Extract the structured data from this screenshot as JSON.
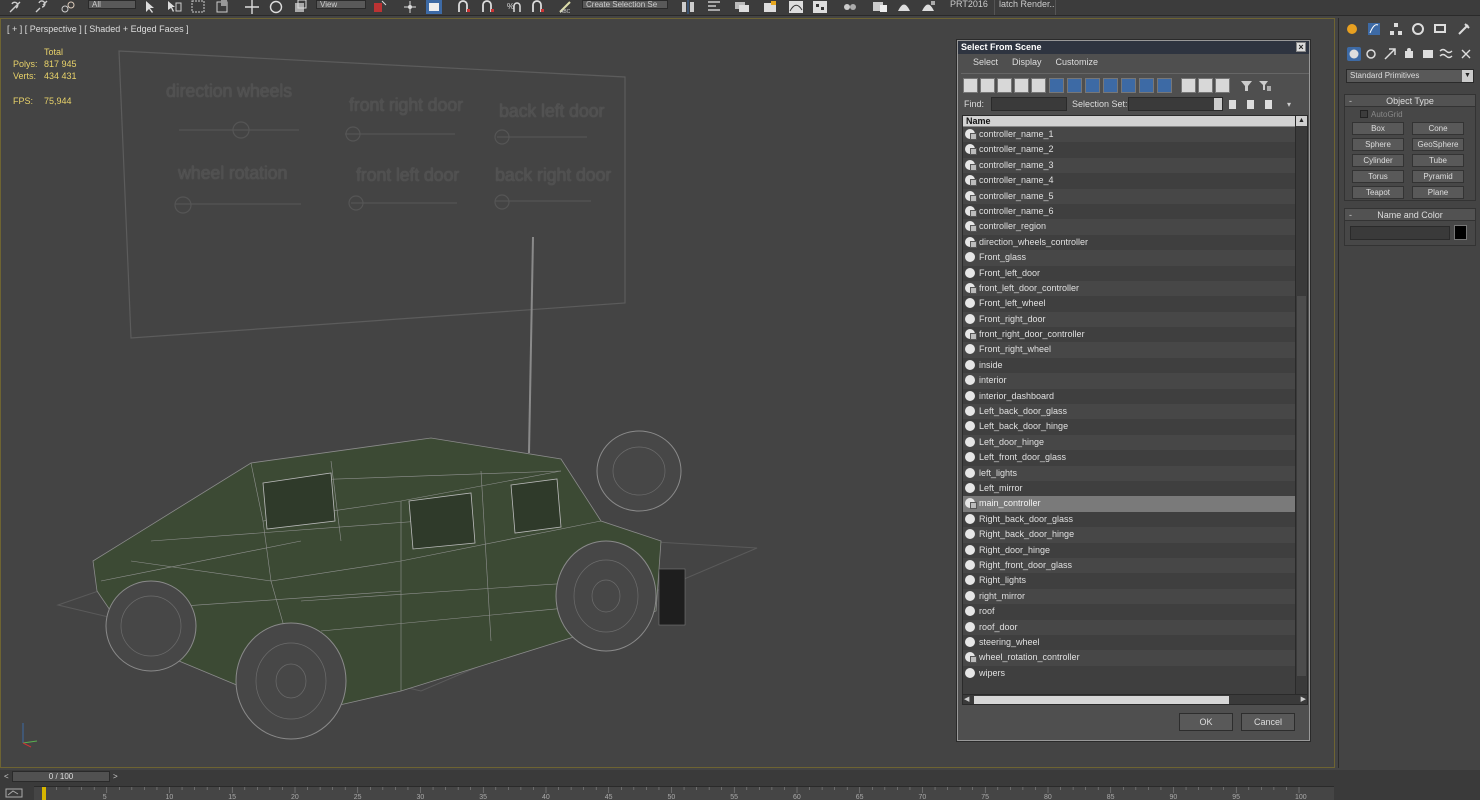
{
  "toolbar": {
    "combo_filter": "All",
    "combo_view": "View",
    "combo_selection_set": "Create Selection Se",
    "prt_label": "PRT2016",
    "batch_render_label": "latch Render.."
  },
  "viewport": {
    "label": "[ + ] [ Perspective ] [ Shaded + Edged Faces ]",
    "stats": {
      "header": "Total",
      "polys_label": "Polys:",
      "polys_value": "817 945",
      "verts_label": "Verts:",
      "verts_value": "434 431",
      "fps_label": "FPS:",
      "fps_value": "75,944"
    },
    "controller_labels": {
      "direction_wheels": "direction wheels",
      "front_right_door": "front right door",
      "back_left_door": "back left door",
      "wheel_rotation": "wheel rotation",
      "front_left_door": "front left door",
      "back_right_door": "back right door"
    }
  },
  "dialog": {
    "title": "Select From Scene",
    "close": "×",
    "menu": [
      "Select",
      "Display",
      "Customize"
    ],
    "find_label": "Find:",
    "selection_set_label": "Selection Set:",
    "column_name": "Name",
    "items": [
      {
        "name": "controller_name_1",
        "kind": "controller"
      },
      {
        "name": "controller_name_2",
        "kind": "controller"
      },
      {
        "name": "controller_name_3",
        "kind": "controller"
      },
      {
        "name": "controller_name_4",
        "kind": "controller"
      },
      {
        "name": "controller_name_5",
        "kind": "controller"
      },
      {
        "name": "controller_name_6",
        "kind": "controller"
      },
      {
        "name": "controller_region",
        "kind": "controller"
      },
      {
        "name": "direction_wheels_controller",
        "kind": "controller"
      },
      {
        "name": "Front_glass",
        "kind": "geometry"
      },
      {
        "name": "Front_left_door",
        "kind": "geometry"
      },
      {
        "name": "front_left_door_controller",
        "kind": "controller"
      },
      {
        "name": "Front_left_wheel",
        "kind": "geometry"
      },
      {
        "name": "Front_right_door",
        "kind": "geometry"
      },
      {
        "name": "front_right_door_controller",
        "kind": "controller"
      },
      {
        "name": "Front_right_wheel",
        "kind": "geometry"
      },
      {
        "name": "inside",
        "kind": "geometry"
      },
      {
        "name": "interior",
        "kind": "geometry"
      },
      {
        "name": "interior_dashboard",
        "kind": "geometry"
      },
      {
        "name": "Left_back_door_glass",
        "kind": "geometry"
      },
      {
        "name": "Left_back_door_hinge",
        "kind": "geometry"
      },
      {
        "name": "Left_door_hinge",
        "kind": "geometry"
      },
      {
        "name": "Left_front_door_glass",
        "kind": "geometry"
      },
      {
        "name": "left_lights",
        "kind": "geometry"
      },
      {
        "name": "Left_mirror",
        "kind": "geometry"
      },
      {
        "name": "main_controller",
        "kind": "controller",
        "selected": true
      },
      {
        "name": "Right_back_door_glass",
        "kind": "geometry"
      },
      {
        "name": "Right_back_door_hinge",
        "kind": "geometry"
      },
      {
        "name": "Right_door_hinge",
        "kind": "geometry"
      },
      {
        "name": "Right_front_door_glass",
        "kind": "geometry"
      },
      {
        "name": "Right_lights",
        "kind": "geometry"
      },
      {
        "name": "right_mirror",
        "kind": "geometry"
      },
      {
        "name": "roof",
        "kind": "geometry"
      },
      {
        "name": "roof_door",
        "kind": "geometry"
      },
      {
        "name": "steering_wheel",
        "kind": "geometry"
      },
      {
        "name": "wheel_rotation_controller",
        "kind": "controller"
      },
      {
        "name": "wipers",
        "kind": "geometry"
      }
    ],
    "ok_label": "OK",
    "cancel_label": "Cancel"
  },
  "command_panel": {
    "category": "Standard Primitives",
    "object_type_title": "Object Type",
    "autogrid_label": "AutoGrid",
    "object_buttons": [
      "Box",
      "Cone",
      "Sphere",
      "GeoSphere",
      "Cylinder",
      "Tube",
      "Torus",
      "Pyramid",
      "Teapot",
      "Plane"
    ],
    "name_color_title": "Name and Color",
    "object_color": "#000000"
  },
  "timeline": {
    "frame_label": "0 / 100",
    "prev": "<",
    "next": ">",
    "ticks": [
      "5",
      "10",
      "15",
      "20",
      "25",
      "30",
      "35",
      "40",
      "45",
      "50",
      "55",
      "60",
      "65",
      "70",
      "75",
      "80",
      "85",
      "90",
      "95",
      "100"
    ]
  },
  "colors": {
    "accent_blue": "#3d6aa5",
    "stats_yellow": "#e8d26a",
    "viewport_border": "#6e6432",
    "wire_green": "#3c4a34",
    "timeline_marker": "#d6b500"
  }
}
